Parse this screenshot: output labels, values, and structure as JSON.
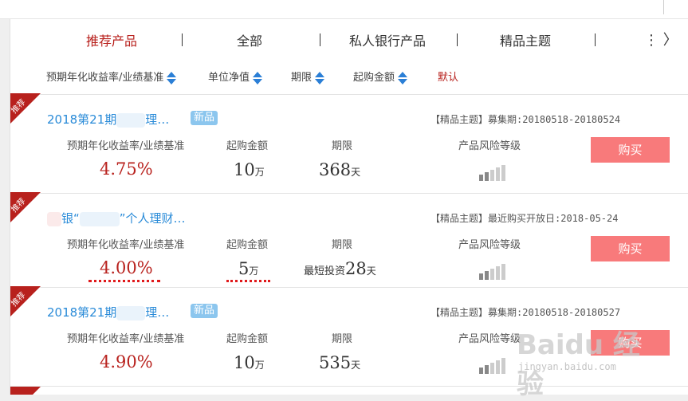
{
  "tabs": [
    {
      "label": "推荐产品",
      "active": true
    },
    {
      "label": "全部",
      "active": false
    },
    {
      "label": "私人银行产品",
      "active": false
    },
    {
      "label": "精品主题",
      "active": false
    }
  ],
  "tab_more": "⋮ 〉",
  "sort": {
    "yield": "预期年化收益率/业绩基准",
    "nav": "单位净值",
    "term": "期限",
    "min_amount": "起购金额",
    "default": "默认"
  },
  "labels": {
    "yield": "预期年化收益率/业绩基准",
    "min_amount": "起购金额",
    "term": "期限",
    "risk": "产品风险等级",
    "badge": "推荐",
    "new": "新品"
  },
  "products": [
    {
      "name_a": "2018第21期",
      "name_b": "理…",
      "is_new": true,
      "info": "【精品主题】募集期:20180518-20180524",
      "yield": "4.75%",
      "amount_num": "10",
      "amount_unit": "万",
      "term_prefix": "",
      "term_num": "368",
      "term_unit": "天",
      "risk_level": 2,
      "buy": "购买"
    },
    {
      "name_a": "银“",
      "name_b": "”个人理财…",
      "is_new": false,
      "info": "【精品主题】最近购买开放日:2018-05-24",
      "yield": "4.00%",
      "amount_num": "5",
      "amount_unit": "万",
      "term_prefix": "最短投资",
      "term_num": "28",
      "term_unit": "天",
      "risk_level": 2,
      "buy": "购买"
    },
    {
      "name_a": "2018第21期",
      "name_b": "理…",
      "is_new": true,
      "info": "【精品主题】募集期:20180518-20180527",
      "yield": "4.90%",
      "amount_num": "10",
      "amount_unit": "万",
      "term_prefix": "",
      "term_num": "535",
      "term_unit": "天",
      "risk_level": 2,
      "buy": "购买"
    }
  ],
  "watermark": {
    "brand": "Baidu 经验",
    "url": "jingyan.baidu.com"
  },
  "colors": {
    "accent_red": "#b8211d",
    "buy_button": "#f87a7b",
    "link_blue": "#2a8bd8",
    "sort_arrow": "#2b7fd6"
  }
}
